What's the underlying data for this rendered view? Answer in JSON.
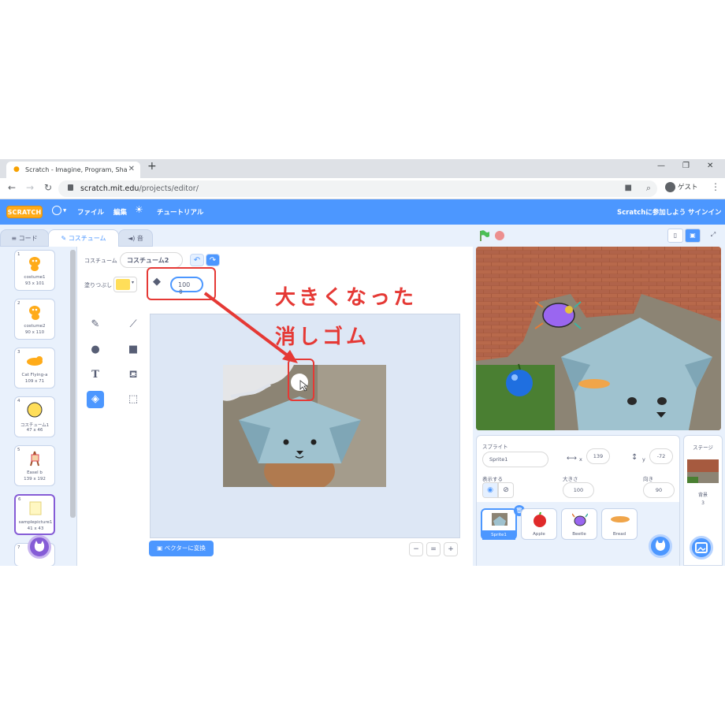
{
  "browser": {
    "tab_title": "Scratch - Imagine, Program, Share",
    "url_host": "scratch.mit.edu",
    "url_path": "/projects/editor/",
    "profile": "ゲスト"
  },
  "menubar": {
    "logo": "SCRATCH",
    "file": "ファイル",
    "edit": "編集",
    "tutorials": "チュートリアル",
    "join": "Scratchに参加しよう",
    "signin": "サインイン"
  },
  "editor_tabs": {
    "code": "コード",
    "costumes": "コスチューム",
    "sounds": "音"
  },
  "costumes": [
    {
      "num": "1",
      "name": "costume1",
      "size": "93 x 101"
    },
    {
      "num": "2",
      "name": "costume2",
      "size": "90 x 110"
    },
    {
      "num": "3",
      "name": "Cat Flying-a",
      "size": "109 x 71"
    },
    {
      "num": "4",
      "name": "コスチューム1",
      "size": "47 x 46"
    },
    {
      "num": "5",
      "name": "Easel b",
      "size": "139 x 192"
    },
    {
      "num": "6",
      "name": "samplepicture1",
      "size": "41 x 43"
    },
    {
      "num": "7",
      "name": "",
      "size": ""
    }
  ],
  "paint": {
    "costume_label": "コスチューム",
    "costume_name": "コスチューム2",
    "fill_label": "塗りつぶし",
    "eraser_size": "100",
    "convert_button": "ベクターに変換",
    "zoom_reset": "="
  },
  "annotation": {
    "line1": "大きくなった",
    "line2": "消しゴム"
  },
  "sprite": {
    "label": "スプライト",
    "name": "Sprite1",
    "x_label": "x",
    "x": "139",
    "y_label": "y",
    "y": "-72",
    "show_label": "表示する",
    "size_label": "大きさ",
    "size": "100",
    "direction_label": "向き",
    "direction": "90"
  },
  "sprites": [
    "Sprite1",
    "Apple",
    "Beetle",
    "Bread"
  ],
  "stage_panel": {
    "title": "ステージ",
    "backdrops_label": "背景",
    "backdrops_count": "3"
  },
  "colors": {
    "scratch_blue": "#4c97ff",
    "annotation_red": "#e53935",
    "fill_color": "#ffde59"
  }
}
